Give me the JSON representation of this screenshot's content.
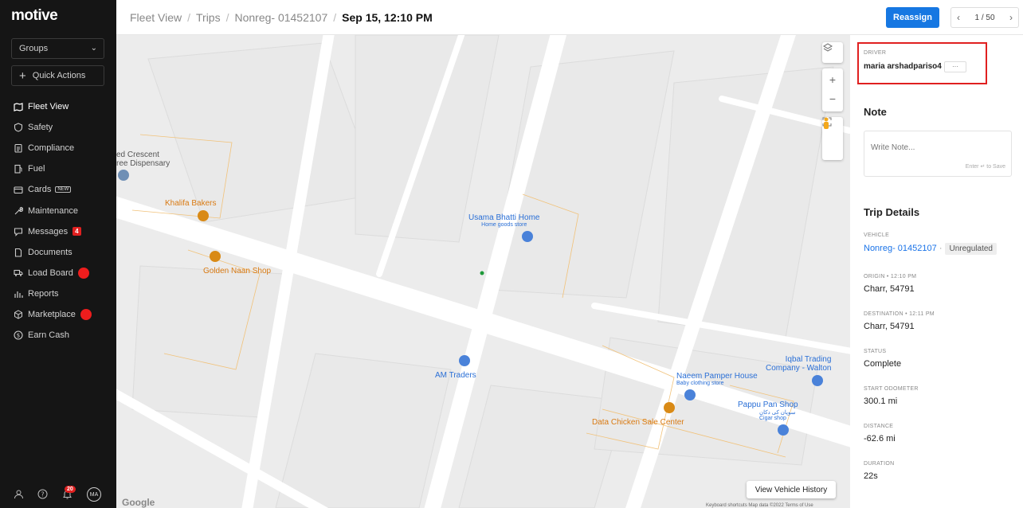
{
  "sidebar": {
    "logo": "motive",
    "groups": "Groups",
    "quick_actions": "Quick Actions",
    "items": [
      {
        "label": "Fleet View",
        "icon": "map-icon"
      },
      {
        "label": "Safety",
        "icon": "shield-icon"
      },
      {
        "label": "Compliance",
        "icon": "clipboard-icon"
      },
      {
        "label": "Fuel",
        "icon": "fuel-icon"
      },
      {
        "label": "Cards",
        "icon": "card-icon",
        "badge": "NEW"
      },
      {
        "label": "Maintenance",
        "icon": "wrench-icon"
      },
      {
        "label": "Messages",
        "icon": "chat-icon",
        "count": "4"
      },
      {
        "label": "Documents",
        "icon": "document-icon"
      },
      {
        "label": "Load Board",
        "icon": "truck-icon"
      },
      {
        "label": "Reports",
        "icon": "chart-icon"
      },
      {
        "label": "Marketplace",
        "icon": "cube-icon"
      },
      {
        "label": "Earn Cash",
        "icon": "dollar-icon"
      }
    ],
    "notifications_count": "20",
    "avatar_initials": "MA"
  },
  "header": {
    "breadcrumbs": [
      "Fleet View",
      "Trips",
      "Nonreg- 01452107"
    ],
    "current": "Sep 15, 12:10 PM",
    "reassign": "Reassign",
    "pager": "1 / 50"
  },
  "map": {
    "pois": {
      "red_crescent": "ed Crescent",
      "red_crescent_2": "ree Dispensary",
      "khalifa": "Khalifa Bakers",
      "golden_naan": "Golden Naan Shop",
      "usama": "Usama Bhatti Home",
      "usama_sub": "Home goods store",
      "am_traders": "AM Traders",
      "iqbal": "Iqbal Trading",
      "iqbal_2": "Company - Walton",
      "naeem": "Naeem Pamper House",
      "naeem_sub": "Baby clothing store",
      "pappu": "Pappu Pan Shop",
      "pappu_urdu": "سوپان کی دکان",
      "pappu_sub": "Cigar shop",
      "data_chicken": "Data Chicken Sale Center"
    },
    "view_history": "View Vehicle History",
    "google": "Google",
    "attribution": "Keyboard shortcuts   Map data ©2022   Terms of Use"
  },
  "panel": {
    "driver_label": "DRIVER",
    "driver_name": "maria arshadpariso4",
    "driver_more": "···",
    "note_title": "Note",
    "note_placeholder": "Write Note...",
    "note_hint": "Enter ↵ to Save",
    "trip_title": "Trip Details",
    "vehicle_label": "VEHICLE",
    "vehicle_value": "Nonreg- 01452107",
    "vehicle_tag": "Unregulated",
    "origin_label": "ORIGIN • 12:10 PM",
    "origin_value": "Charr, 54791",
    "dest_label": "DESTINATION • 12:11 PM",
    "dest_value": "Charr, 54791",
    "status_label": "STATUS",
    "status_value": "Complete",
    "odo_label": "START ODOMETER",
    "odo_value": "300.1 mi",
    "dist_label": "DISTANCE",
    "dist_value": "-62.6 mi",
    "dur_label": "DURATION",
    "dur_value": "22s"
  },
  "colors": {
    "accent": "#1677e2",
    "sidebar": "#151515",
    "alert": "#e02020"
  }
}
